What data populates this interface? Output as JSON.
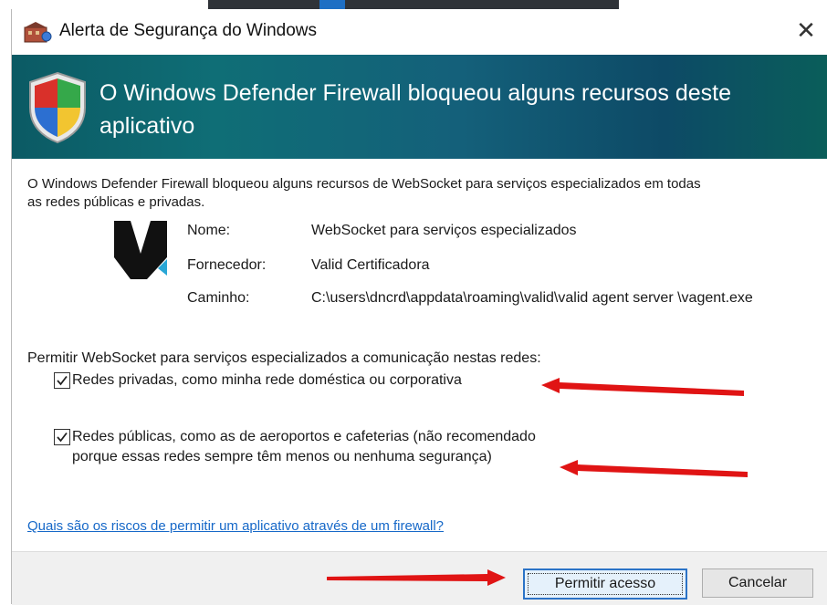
{
  "window": {
    "title": "Alerta de Segurança do Windows",
    "close_glyph": "✕"
  },
  "banner": {
    "heading": "O Windows Defender Firewall bloqueou alguns recursos deste aplicativo"
  },
  "body": {
    "description": "O Windows Defender Firewall bloqueou alguns recursos de WebSocket para serviços especializados em todas as redes públicas e privadas.",
    "app_info": {
      "name_label": "Nome:",
      "name_value": "WebSocket para serviços especializados",
      "publisher_label": "Fornecedor:",
      "publisher_value": "Valid Certificadora",
      "path_label": "Caminho:",
      "path_value": "C:\\users\\dncrd\\appdata\\roaming\\valid\\valid agent server \\vagent.exe"
    },
    "allow_prompt": "Permitir WebSocket para serviços especializados a comunicação nestas redes:",
    "private_network": {
      "label": "Redes privadas, como minha rede doméstica ou corporativa",
      "checked": true
    },
    "public_network": {
      "label_line1": "Redes públicas, como as de aeroportos e cafeterias (não recomendado",
      "label_line2": "porque essas redes sempre têm menos ou nenhuma segurança)",
      "checked": true
    },
    "risk_link": "Quais são os riscos de permitir um aplicativo através de um firewall?"
  },
  "footer": {
    "allow_button": "Permitir acesso",
    "cancel_button": "Cancelar"
  },
  "colors": {
    "banner": "#0f6e76",
    "link": "#1668c8",
    "annotation_arrow": "#e01414"
  },
  "icons": [
    "security-alert-icon",
    "shield-icon",
    "app-logo-icon",
    "close-icon",
    "check-icon",
    "arrow-annotation"
  ]
}
